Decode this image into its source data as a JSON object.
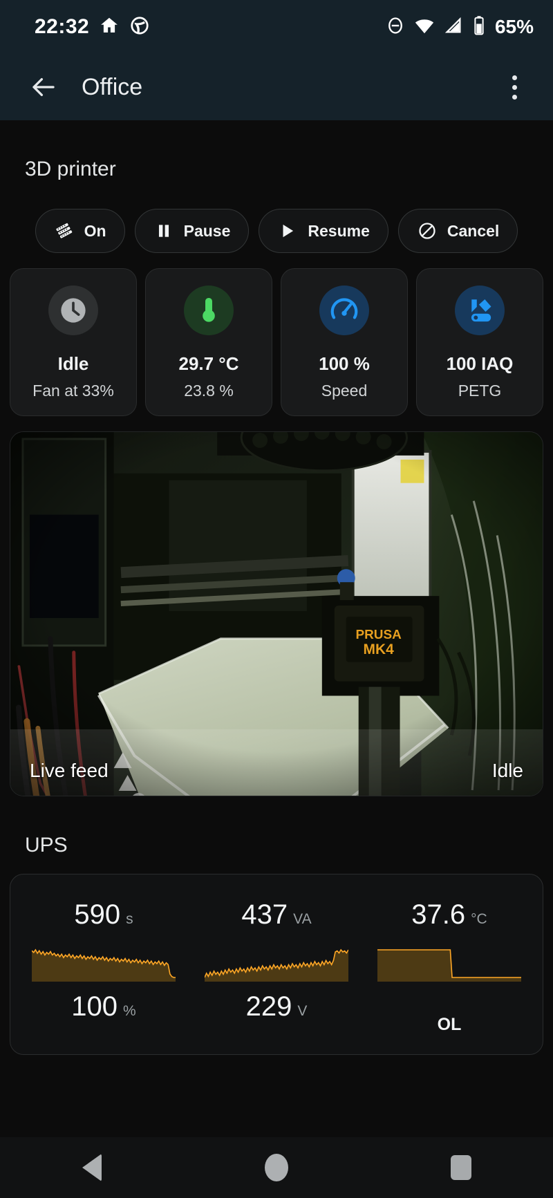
{
  "statusbar": {
    "time": "22:32",
    "icons_left": [
      "home-icon",
      "car-dashboard-icon"
    ],
    "icons_right": [
      "do-not-disturb-icon",
      "wifi-icon",
      "cell-signal-icon",
      "battery-icon"
    ],
    "battery_percent": "65%"
  },
  "appbar": {
    "back_icon": "arrow-back-icon",
    "title": "Office",
    "overflow_icon": "overflow-menu-icon"
  },
  "printer": {
    "section_title": "3D printer",
    "actions": [
      {
        "label": "On",
        "icon": "filament-icon"
      },
      {
        "label": "Pause",
        "icon": "pause-icon"
      },
      {
        "label": "Resume",
        "icon": "play-icon"
      },
      {
        "label": "Cancel",
        "icon": "cancel-icon"
      }
    ],
    "tiles": [
      {
        "icon": "clock-icon",
        "icon_color": "#b0b3b5",
        "bg": "#2e3031",
        "main": "Idle",
        "sub": "Fan at 33%"
      },
      {
        "icon": "thermometer-icon",
        "icon_color": "#4cd964",
        "bg": "#1d3b22",
        "main": "29.7 °C",
        "sub": "23.8 %"
      },
      {
        "icon": "speedometer-icon",
        "icon_color": "#2196f3",
        "bg": "#17395c",
        "main": "100 %",
        "sub": "Speed"
      },
      {
        "icon": "filament-roll-icon",
        "icon_color": "#2196f3",
        "bg": "#17395c",
        "main": "100 IAQ",
        "sub": "PETG"
      }
    ],
    "camera": {
      "label": "Live feed",
      "status": "Idle",
      "printer_brand": "PRUSA",
      "printer_model": "MK4"
    }
  },
  "ups": {
    "section_title": "UPS",
    "metrics": [
      {
        "value": "590",
        "unit": "s",
        "status": "100",
        "status_unit": "%"
      },
      {
        "value": "437",
        "unit": "VA",
        "status": "229",
        "status_unit": "V"
      },
      {
        "value": "37.6",
        "unit": "°C",
        "status": "OL",
        "status_unit": ""
      }
    ],
    "accent_color": "#ffa726"
  },
  "navbar": {
    "back_icon": "nav-back-icon",
    "home_icon": "nav-home-icon",
    "recents_icon": "nav-recents-icon"
  },
  "chart_data": [
    {
      "type": "line",
      "title": "Runtime sparkline",
      "ylabel": "s",
      "values": [
        52,
        50,
        53,
        49,
        52,
        48,
        51,
        47,
        50,
        48,
        51,
        47,
        49,
        46,
        48,
        45,
        48,
        44,
        47,
        45,
        48,
        44,
        47,
        43,
        46,
        44,
        47,
        43,
        46,
        42,
        45,
        43,
        46,
        42,
        45,
        41,
        44,
        42,
        45,
        41,
        44,
        40,
        43,
        41,
        44,
        40,
        43,
        39,
        42,
        40,
        43,
        39,
        42,
        38,
        41,
        39,
        42,
        38,
        41,
        37,
        40,
        38,
        41,
        37,
        40,
        36,
        39,
        37,
        40,
        36,
        39,
        35,
        38,
        36,
        25,
        22,
        21,
        21
      ]
    },
    {
      "type": "line",
      "title": "Load sparkline",
      "ylabel": "VA",
      "values": [
        62,
        70,
        64,
        72,
        66,
        74,
        68,
        72,
        66,
        74,
        68,
        76,
        70,
        78,
        72,
        76,
        70,
        78,
        72,
        80,
        74,
        78,
        72,
        80,
        74,
        82,
        76,
        80,
        74,
        82,
        76,
        84,
        78,
        82,
        76,
        84,
        78,
        86,
        80,
        84,
        78,
        86,
        80,
        84,
        78,
        86,
        80,
        88,
        82,
        86,
        80,
        88,
        82,
        90,
        84,
        88,
        82,
        90,
        84,
        92,
        86,
        90,
        84,
        92,
        86,
        94,
        88,
        92,
        86,
        94,
        110,
        112,
        108,
        114,
        110,
        112,
        108,
        114
      ]
    },
    {
      "type": "line",
      "title": "Temperature sparkline",
      "ylabel": "°C",
      "values": [
        86,
        86,
        86,
        86,
        86,
        86,
        86,
        86,
        86,
        86,
        86,
        86,
        86,
        86,
        86,
        86,
        86,
        86,
        86,
        86,
        86,
        86,
        86,
        86,
        86,
        86,
        86,
        86,
        86,
        86,
        86,
        86,
        86,
        86,
        86,
        86,
        86,
        86,
        86,
        86,
        84,
        84,
        84,
        84,
        84,
        84,
        84,
        84,
        84,
        84,
        84,
        84,
        84,
        84,
        84,
        84,
        84,
        84,
        84,
        84,
        84,
        84,
        84,
        84,
        84,
        84,
        84,
        84,
        84,
        84,
        84,
        84,
        84,
        84,
        84,
        84,
        84,
        84
      ]
    }
  ]
}
